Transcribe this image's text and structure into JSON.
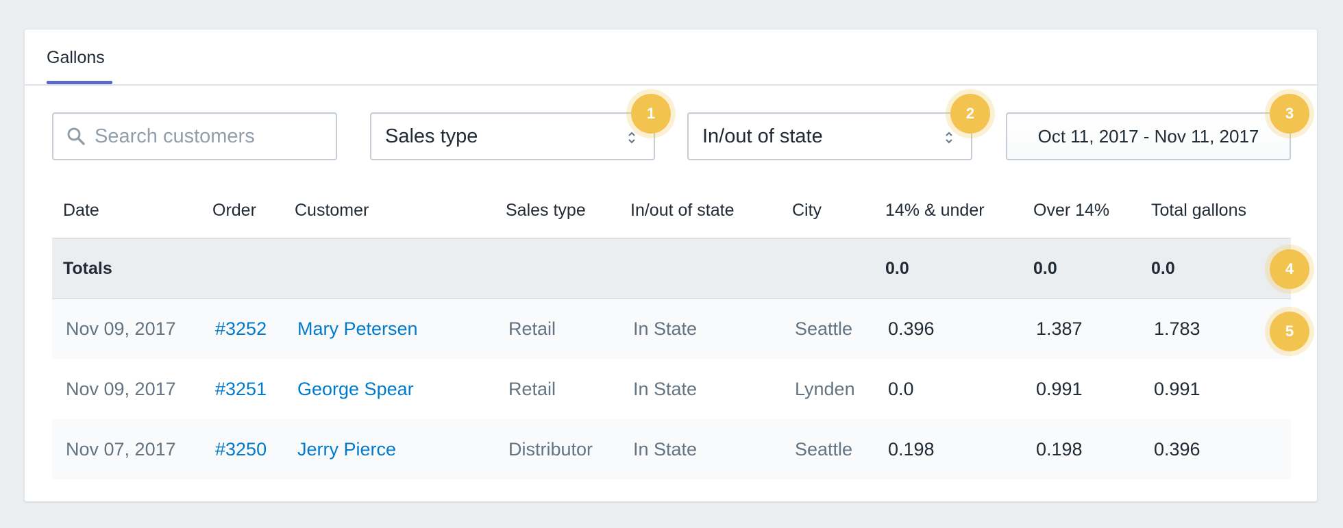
{
  "tabs": {
    "active": "Gallons"
  },
  "filters": {
    "search_placeholder": "Search customers",
    "sales_type_label": "Sales type",
    "state_label": "In/out of state",
    "date_range_label": "Oct 11, 2017 - Nov 11, 2017"
  },
  "badges": [
    "1",
    "2",
    "3",
    "4",
    "5"
  ],
  "table": {
    "columns": [
      "Date",
      "Order",
      "Customer",
      "Sales type",
      "In/out of state",
      "City",
      "14% & under",
      "Over 14%",
      "Total gallons"
    ],
    "totals": {
      "label": "Totals",
      "under14": "0.0",
      "over14": "0.0",
      "total": "0.0"
    },
    "rows": [
      {
        "date": "Nov 09, 2017",
        "order": "#3252",
        "customer": "Mary Petersen",
        "sales_type": "Retail",
        "state": "In State",
        "city": "Seattle",
        "under14": "0.396",
        "over14": "1.387",
        "total": "1.783"
      },
      {
        "date": "Nov 09, 2017",
        "order": "#3251",
        "customer": "George Spear",
        "sales_type": "Retail",
        "state": "In State",
        "city": "Lynden",
        "under14": "0.0",
        "over14": "0.991",
        "total": "0.991"
      },
      {
        "date": "Nov 07, 2017",
        "order": "#3250",
        "customer": "Jerry Pierce",
        "sales_type": "Distributor",
        "state": "In State",
        "city": "Seattle",
        "under14": "0.198",
        "over14": "0.198",
        "total": "0.396"
      }
    ]
  },
  "colors": {
    "accent": "#5c6ac4",
    "link": "#007ace",
    "badge": "#f3c34f",
    "page_bg": "#ebeef1"
  }
}
